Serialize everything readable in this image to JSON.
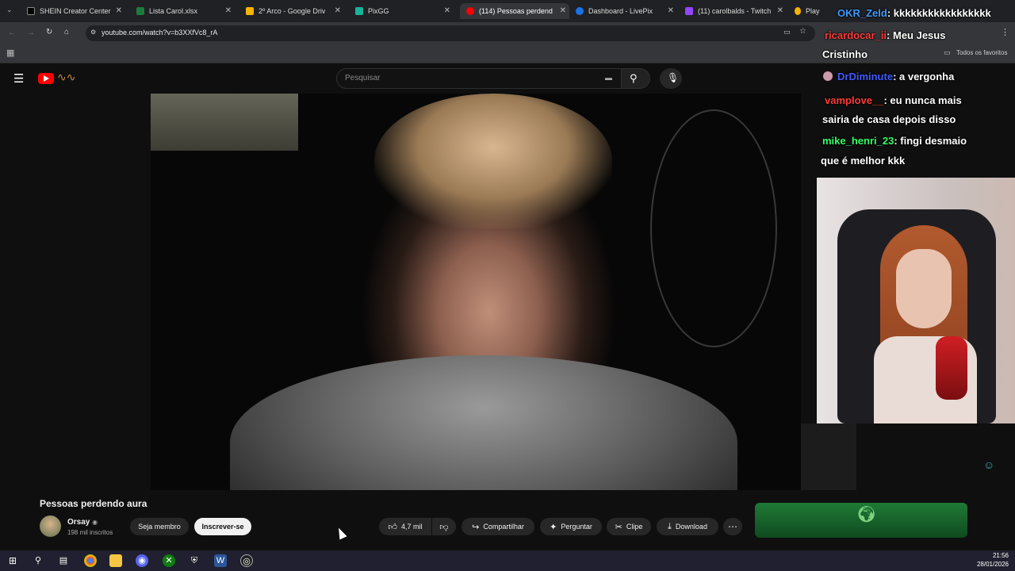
{
  "browser": {
    "tabs": [
      {
        "label": "SHEIN Creator Center",
        "color": "#000000"
      },
      {
        "label": "Lista Carol.xlsx",
        "color": "#1e7a3c"
      },
      {
        "label": "2º Arco - Google Driv",
        "color": "#f4b400"
      },
      {
        "label": "PixGG",
        "color": "#19b39a"
      },
      {
        "label": "(114) Pessoas perdend",
        "color": "#ff0000"
      },
      {
        "label": "Dashboard - LivePix",
        "color": "#1a73e8"
      },
      {
        "label": "(11) carolbalds - Twitch",
        "color": "#9146ff"
      },
      {
        "label": "Play |",
        "color": "#f4b400"
      }
    ],
    "url": "youtube.com/watch?v=b3XXfVc8_rA",
    "bookmark_folder": "Todos os favoritos"
  },
  "youtube": {
    "search_placeholder": "Pesquisar",
    "video_title": "Pessoas perdendo aura",
    "channel_name": "Orsay",
    "subscribers": "198 mil inscritos",
    "member_label": "Seja membro",
    "subscribe_label": "Inscrever-se",
    "like_count": "4,7 mil",
    "share_label": "Compartilhar",
    "ask_label": "Perguntar",
    "clip_label": "Clipe",
    "download_label": "Download"
  },
  "chat": [
    {
      "user": "OKR_Zeld",
      "text": ": kkkkkkkkkkkkkkkkk",
      "color": "#3d9aff"
    },
    {
      "user": "ricardocar_ii",
      "text": ": Meu Jesus",
      "color": "#ff3b3b"
    },
    {
      "user": "",
      "text": "Cristinho",
      "color": "#ffffff"
    },
    {
      "user": "DrDiminute",
      "text": ": a vergonha",
      "color": "#3d5bff"
    },
    {
      "user": "vamplove__",
      "text": ": eu nunca mais",
      "color": "#ff3b3b"
    },
    {
      "user": "",
      "text": "sairia de casa depois disso",
      "color": "#ffffff"
    },
    {
      "user": "mike_henri_23",
      "text": ": fingi desmaio",
      "color": "#33ff66"
    },
    {
      "user": "",
      "text": "que é melhor kkk",
      "color": "#ffffff"
    }
  ],
  "taskbar": {
    "time": "21:56",
    "date": "28/01/2026"
  }
}
